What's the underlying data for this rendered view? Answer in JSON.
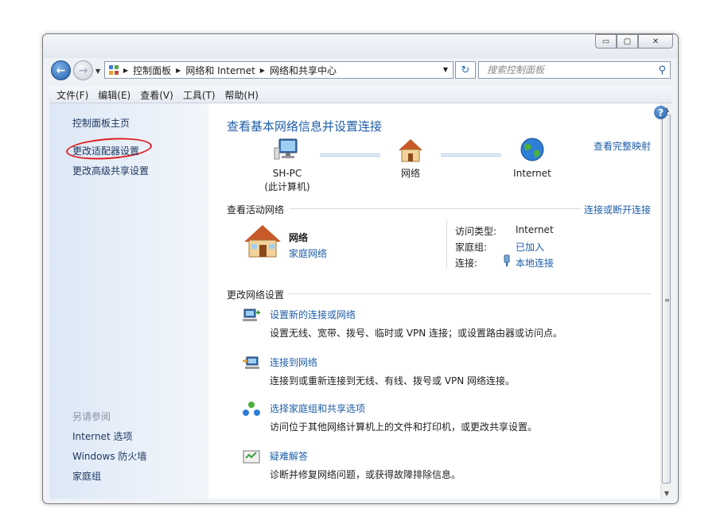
{
  "window": {
    "minimize_glyph": "▭",
    "maximize_glyph": "▢",
    "close_glyph": "✕"
  },
  "nav": {
    "back_glyph": "←",
    "forward_glyph": "→",
    "breadcrumb": [
      "控制面板",
      "网络和 Internet",
      "网络和共享中心"
    ],
    "refresh_glyph": "↻",
    "search_placeholder": "搜索控制面板",
    "search_glyph": "⚲"
  },
  "menu": [
    "文件(F)",
    "编辑(E)",
    "查看(V)",
    "工具(T)",
    "帮助(H)"
  ],
  "sidebar": {
    "links": [
      "控制面板主页",
      "更改适配器设置",
      "更改高级共享设置"
    ],
    "see_also_label": "另请参阅",
    "see_also": [
      "Internet 选项",
      "Windows 防火墙",
      "家庭组"
    ]
  },
  "main": {
    "title": "查看基本网络信息并设置连接",
    "full_map_link": "查看完整映射",
    "map": {
      "computer_name": "SH-PC",
      "computer_sub": "(此计算机)",
      "network": "网络",
      "internet": "Internet"
    },
    "active_networks": {
      "label": "查看活动网络",
      "connect_link": "连接或断开连接",
      "name": "网络",
      "type": "家庭网络",
      "access_type_label": "访问类型:",
      "access_type_value": "Internet",
      "homegroup_label": "家庭组:",
      "homegroup_value": "已加入",
      "connections_label": "连接:",
      "connections_value": "本地连接"
    },
    "change_settings_label": "更改网络设置",
    "tasks": [
      {
        "title": "设置新的连接或网络",
        "desc": "设置无线、宽带、拨号、临时或 VPN 连接；或设置路由器或访问点。"
      },
      {
        "title": "连接到网络",
        "desc": "连接到或重新连接到无线、有线、拨号或 VPN 网络连接。"
      },
      {
        "title": "选择家庭组和共享选项",
        "desc": "访问位于其他网络计算机上的文件和打印机，或更改共享设置。"
      },
      {
        "title": "疑难解答",
        "desc": "诊断并修复网络问题，或获得故障排除信息。"
      }
    ]
  },
  "help_glyph": "?",
  "scrollbar": {
    "up": "▲",
    "down": "▼",
    "grip": "≡"
  },
  "colors": {
    "link": "#1e5ea8",
    "annotation": "#e02020"
  }
}
